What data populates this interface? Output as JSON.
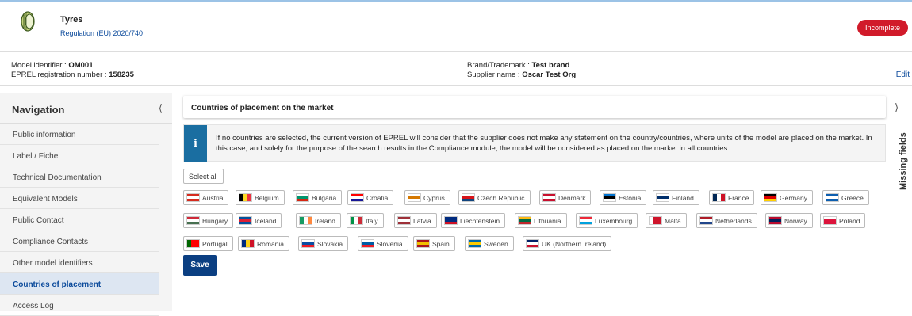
{
  "product": {
    "title": "Tyres",
    "regulation": "Regulation (EU) 2020/740",
    "status": "Incomplete"
  },
  "model": {
    "identifier_label": "Model identifier : ",
    "identifier": "OM001",
    "eprel_label": "EPREL registration number : ",
    "eprel": "158235",
    "brand_label": "Brand/Trademark : ",
    "brand": "Test brand",
    "supplier_label": "Supplier name : ",
    "supplier": "Oscar Test Org",
    "edit": "Edit"
  },
  "navigation": {
    "title": "Navigation",
    "collapse_icon": "chevron-left-icon",
    "items": [
      "Public information",
      "Label / Fiche",
      "Technical Documentation",
      "Equivalent Models",
      "Public Contact",
      "Compliance Contacts",
      "Other model identifiers",
      "Countries of placement",
      "Access Log"
    ],
    "active_index": 7
  },
  "main": {
    "section_title": "Countries of placement on the market",
    "info_icon": "i",
    "info_text": "If no countries are selected, the current version of EPREL will consider that the supplier does not make any statement on the country/countries, where units of the model are placed on the market. In this case, and solely for the purpose of the search results in the Compliance module, the model will be considered as placed on the market in all countries.",
    "select_all": "Select all",
    "save": "Save",
    "countries": [
      {
        "name": "Austria",
        "flag": [
          "#d52b1e",
          "#ffffff",
          "#d52b1e"
        ],
        "dir": "h"
      },
      {
        "name": "Belgium",
        "flag": [
          "#000000",
          "#fdda24",
          "#ef3340"
        ],
        "dir": "v"
      },
      {
        "name": "Bulgaria",
        "flag": [
          "#ffffff",
          "#00966e",
          "#d62612"
        ],
        "dir": "h"
      },
      {
        "name": "Croatia",
        "flag": [
          "#ff0000",
          "#ffffff",
          "#171796"
        ],
        "dir": "h"
      },
      {
        "name": "Cyprus",
        "flag": [
          "#ffffff",
          "#d57800",
          "#ffffff"
        ],
        "dir": "h"
      },
      {
        "name": "Czech Republic",
        "flag": [
          "#ffffff",
          "#d7141a",
          "#11457e"
        ],
        "dir": "h"
      },
      {
        "name": "Denmark",
        "flag": [
          "#c8102e",
          "#ffffff",
          "#c8102e"
        ],
        "dir": "h"
      },
      {
        "name": "Estonia",
        "flag": [
          "#0072ce",
          "#000000",
          "#ffffff"
        ],
        "dir": "h"
      },
      {
        "name": "Finland",
        "flag": [
          "#ffffff",
          "#002f6c",
          "#ffffff"
        ],
        "dir": "h"
      },
      {
        "name": "France",
        "flag": [
          "#002654",
          "#ffffff",
          "#ce1126"
        ],
        "dir": "v"
      },
      {
        "name": "Germany",
        "flag": [
          "#000000",
          "#dd0000",
          "#ffce00"
        ],
        "dir": "h"
      },
      {
        "name": "Greece",
        "flag": [
          "#0d5eaf",
          "#ffffff",
          "#0d5eaf"
        ],
        "dir": "h"
      },
      {
        "name": "Hungary",
        "flag": [
          "#ce2939",
          "#ffffff",
          "#477050"
        ],
        "dir": "h"
      },
      {
        "name": "Iceland",
        "flag": [
          "#02529c",
          "#dc1e35",
          "#02529c"
        ],
        "dir": "h"
      },
      {
        "name": "Ireland",
        "flag": [
          "#169b62",
          "#ffffff",
          "#ff883e"
        ],
        "dir": "v"
      },
      {
        "name": "Italy",
        "flag": [
          "#009246",
          "#ffffff",
          "#ce2b37"
        ],
        "dir": "v"
      },
      {
        "name": "Latvia",
        "flag": [
          "#9e3039",
          "#ffffff",
          "#9e3039"
        ],
        "dir": "h"
      },
      {
        "name": "Liechtenstein",
        "flag": [
          "#002b7f",
          "#002b7f",
          "#ce1126"
        ],
        "dir": "h"
      },
      {
        "name": "Lithuania",
        "flag": [
          "#fdb913",
          "#006a44",
          "#c1272d"
        ],
        "dir": "h"
      },
      {
        "name": "Luxembourg",
        "flag": [
          "#ed2939",
          "#ffffff",
          "#00a1de"
        ],
        "dir": "h"
      },
      {
        "name": "Malta",
        "flag": [
          "#ffffff",
          "#cf142b",
          "#cf142b"
        ],
        "dir": "v"
      },
      {
        "name": "Netherlands",
        "flag": [
          "#ae1c28",
          "#ffffff",
          "#21468b"
        ],
        "dir": "h"
      },
      {
        "name": "Norway",
        "flag": [
          "#ba0c2f",
          "#00205b",
          "#ba0c2f"
        ],
        "dir": "h"
      },
      {
        "name": "Poland",
        "flag": [
          "#ffffff",
          "#dc143c",
          "#dc143c"
        ],
        "dir": "h"
      },
      {
        "name": "Portugal",
        "flag": [
          "#006600",
          "#ff0000",
          "#ff0000"
        ],
        "dir": "v"
      },
      {
        "name": "Romania",
        "flag": [
          "#002b7f",
          "#fcd116",
          "#ce1126"
        ],
        "dir": "v"
      },
      {
        "name": "Slovakia",
        "flag": [
          "#ffffff",
          "#0b4ea2",
          "#ee1c25"
        ],
        "dir": "h"
      },
      {
        "name": "Slovenia",
        "flag": [
          "#ffffff",
          "#005da4",
          "#ed1c24"
        ],
        "dir": "h"
      },
      {
        "name": "Spain",
        "flag": [
          "#aa151b",
          "#f1bf00",
          "#aa151b"
        ],
        "dir": "h"
      },
      {
        "name": "Sweden",
        "flag": [
          "#006aa7",
          "#fecc00",
          "#006aa7"
        ],
        "dir": "h"
      },
      {
        "name": "UK (Northern Ireland)",
        "flag": [
          "#012169",
          "#ffffff",
          "#c8102e"
        ],
        "dir": "h"
      }
    ]
  },
  "right_rail": {
    "arrow_icon": "chevron-right-icon",
    "label": "Missing fields"
  }
}
